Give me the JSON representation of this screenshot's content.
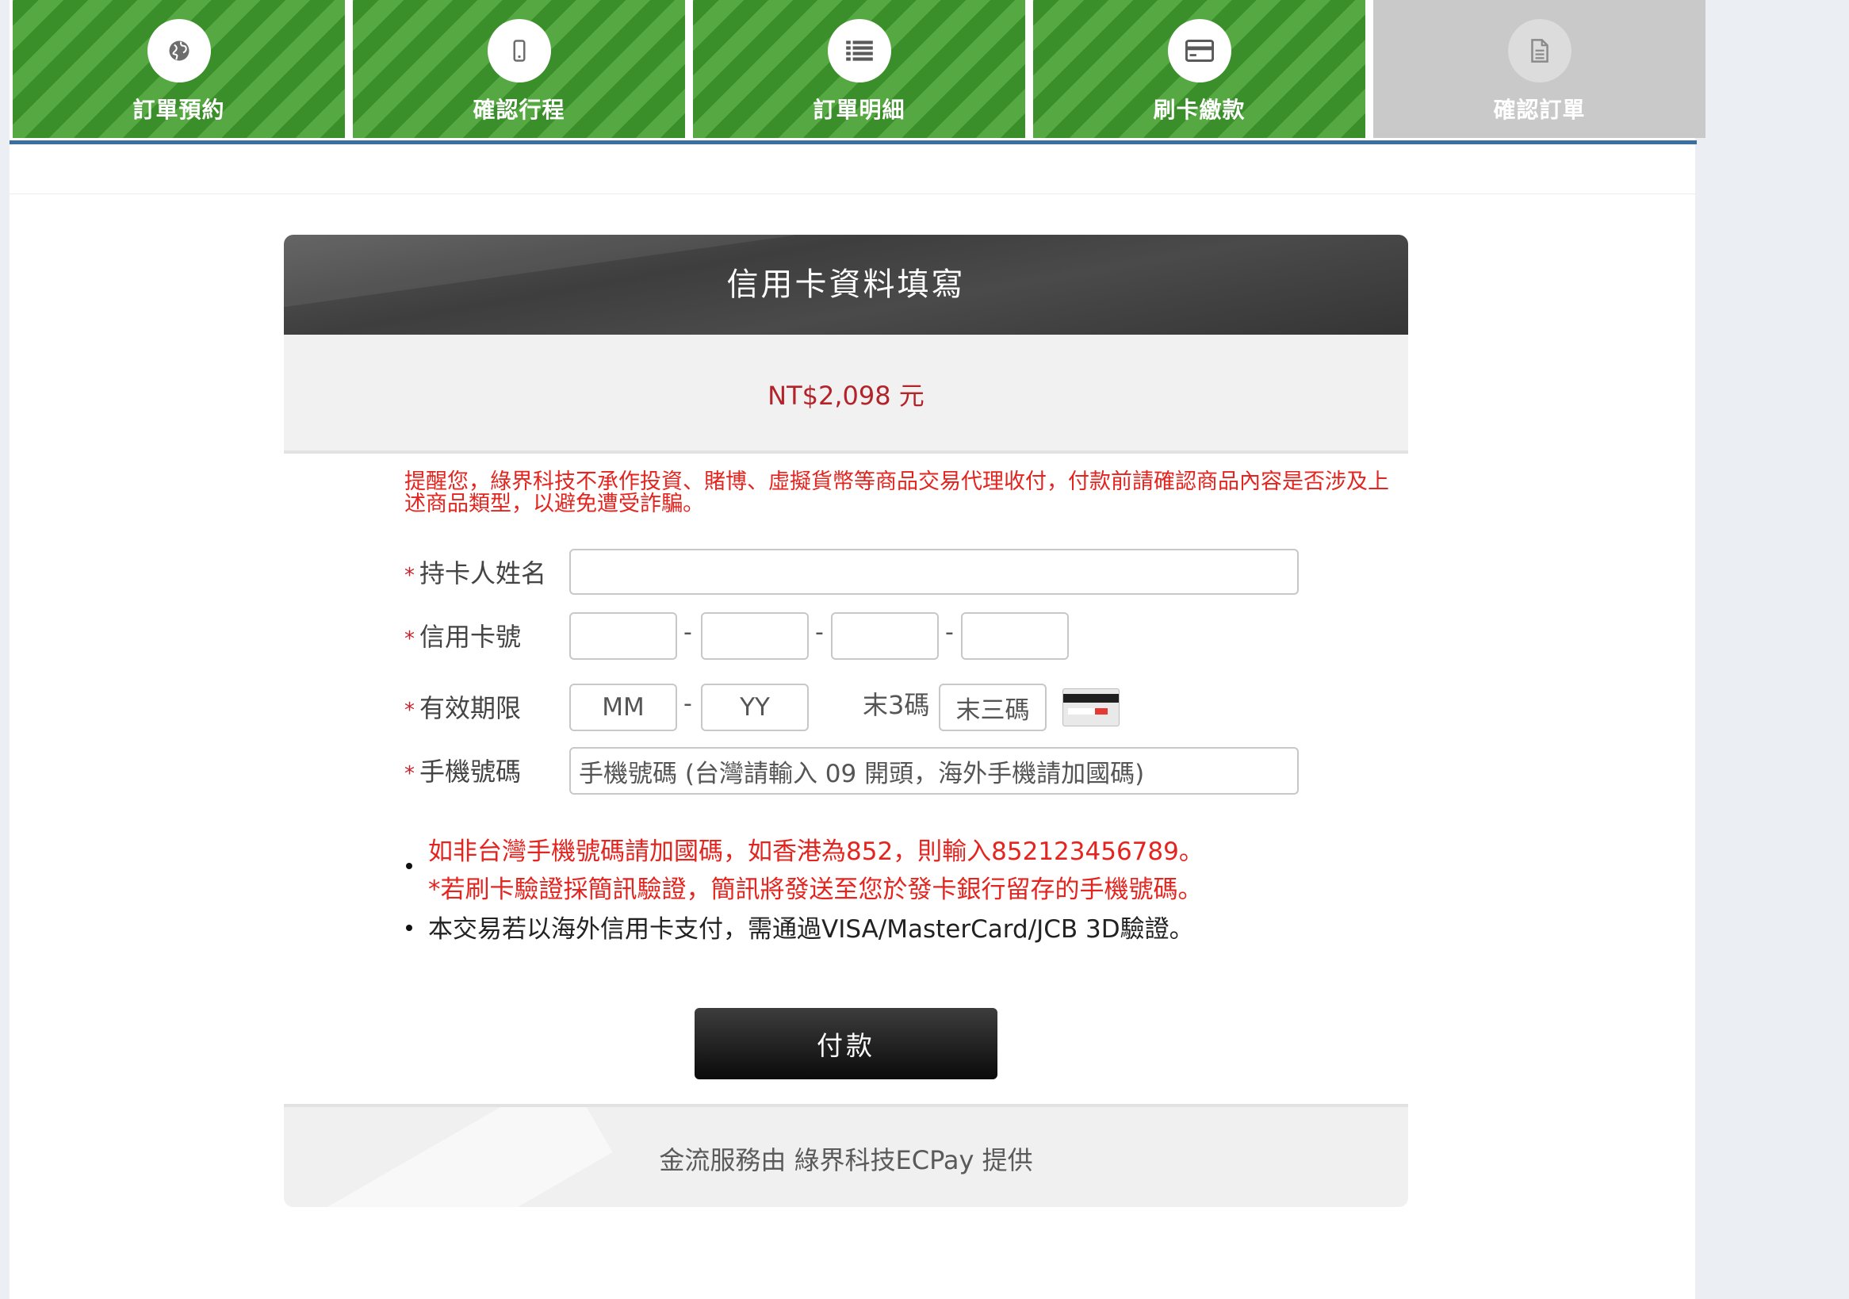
{
  "steps": [
    {
      "label": "訂單預約",
      "icon": "globe-icon",
      "state": "done"
    },
    {
      "label": "確認行程",
      "icon": "mobile-icon",
      "state": "done"
    },
    {
      "label": "訂單明細",
      "icon": "list-icon",
      "state": "done"
    },
    {
      "label": "刷卡繳款",
      "icon": "credit-card-icon",
      "state": "current"
    },
    {
      "label": "確認訂單",
      "icon": "document-icon",
      "state": "pending"
    }
  ],
  "card": {
    "title": "信用卡資料填寫",
    "amount": "NT$2,098 元",
    "notice": "提醒您，綠界科技不承作投資、賭博、虛擬貨幣等商品交易代理收付，付款前請確認商品內容是否涉及上述商品類型，以避免遭受詐騙。"
  },
  "form": {
    "required_mark": "*",
    "cardholder": {
      "label": "持卡人姓名",
      "value": ""
    },
    "card_number": {
      "label": "信用卡號",
      "parts": [
        "",
        "",
        "",
        ""
      ],
      "separator": "-"
    },
    "expiry": {
      "label": "有效期限",
      "month_placeholder": "MM",
      "year_placeholder": "YY",
      "separator": "-"
    },
    "cvc": {
      "label": "末3碼",
      "placeholder": "末三碼"
    },
    "mobile": {
      "label": "手機號碼",
      "placeholder": "手機號碼 (台灣請輸入 09 開頭，海外手機請加國碼)"
    }
  },
  "notes": {
    "intl_code": "如非台灣手機號碼請加國碼，如香港為852，則輸入852123456789。",
    "sms": "*若刷卡驗證採簡訊驗證，簡訊將發送至您於發卡銀行留存的手機號碼。",
    "foreign_card": "本交易若以海外信用卡支付，需通過VISA/MasterCard/JCB 3D驗證。"
  },
  "pay_button": "付款",
  "footer": "金流服務由 綠界科技ECPay 提供",
  "colors": {
    "step_active": "#3a8f2a",
    "step_pending": "#c9c9c9",
    "warning_red": "#e3241f",
    "amount_red": "#b2232a"
  }
}
